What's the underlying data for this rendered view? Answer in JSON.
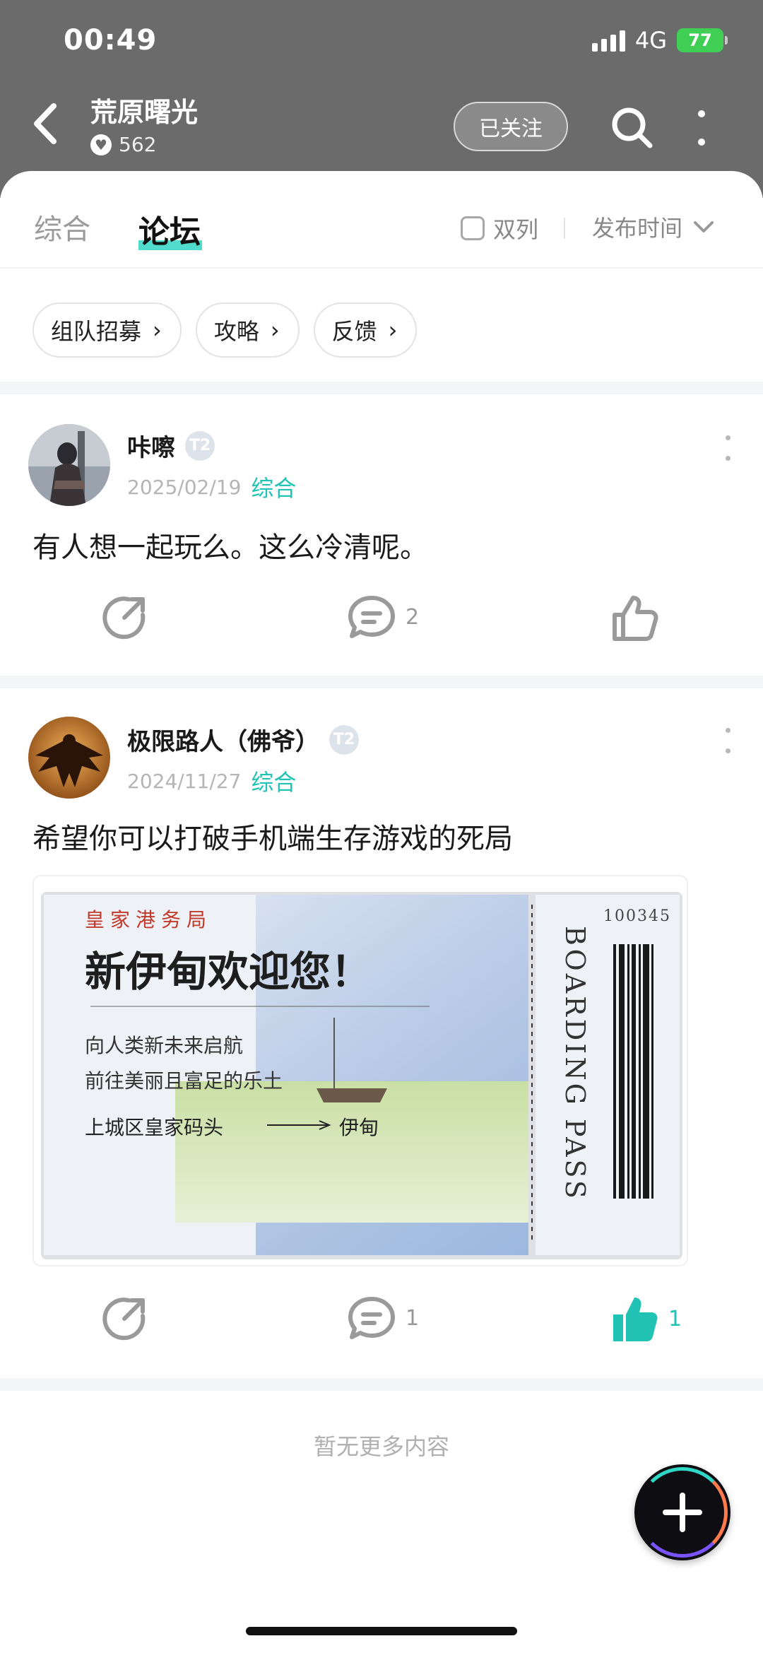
{
  "status_bar": {
    "time": "00:49",
    "network": "4G",
    "battery": "77"
  },
  "header": {
    "title": "荒原曙光",
    "likes": "562",
    "follow_label": "已关注"
  },
  "tabs": [
    {
      "label": "综合"
    },
    {
      "label": "论坛"
    }
  ],
  "view_options": {
    "dual_column_label": "双列",
    "sort_label": "发布时间"
  },
  "chips": [
    {
      "label": "组队招募"
    },
    {
      "label": "攻略"
    },
    {
      "label": "反馈"
    }
  ],
  "posts": [
    {
      "author": "咔嚓",
      "badge": "T2",
      "date": "2025/02/19",
      "category": "综合",
      "content": "有人想一起玩么。这么冷清呢。",
      "comments": "2",
      "likes": "",
      "liked": false
    },
    {
      "author": "极限路人（佛爷）",
      "badge": "T2",
      "date": "2024/11/27",
      "category": "综合",
      "content": "希望你可以打破手机端生存游戏的死局",
      "comments": "1",
      "likes": "1",
      "liked": true,
      "image": {
        "header": "皇家港务局",
        "headline": "新伊甸欢迎您！",
        "line1": "向人类新未来启航",
        "line2": "前往美丽且富足的乐土",
        "route_from": "上城区皇家码头",
        "route_to": "伊甸",
        "side_label": "BOARDING PASS",
        "ticket_no": "100345"
      }
    }
  ],
  "footer": {
    "no_more": "暂无更多内容"
  },
  "colors": {
    "accent": "#22c2b4",
    "header_bg": "#6b6b6b"
  }
}
